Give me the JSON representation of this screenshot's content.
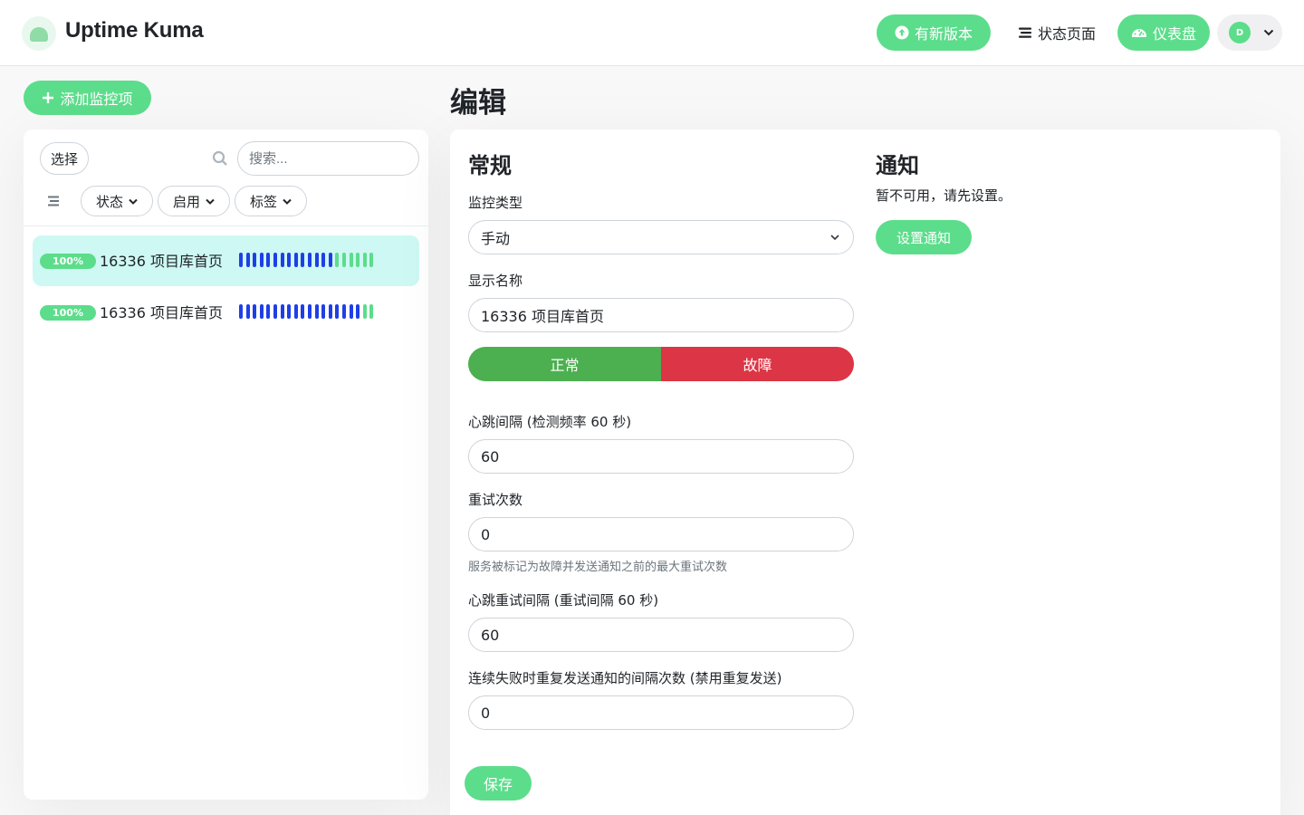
{
  "header": {
    "brand": "Uptime Kuma",
    "update_label": "有新版本",
    "status_page_label": "状态页面",
    "dashboard_label": "仪表盘",
    "avatar_initial": "D"
  },
  "sidebar": {
    "add_monitor_label": "添加监控项",
    "select_label": "选择",
    "search_placeholder": "搜索...",
    "filters": [
      "状态",
      "启用",
      "标签"
    ],
    "monitors": [
      {
        "uptime": "100%",
        "name": "16336 项目库首页",
        "active": true,
        "beats": [
          "down-blue",
          "down-blue",
          "down-blue",
          "down-blue",
          "down-blue",
          "down-blue",
          "down-blue",
          "down-blue",
          "down-blue",
          "down-blue",
          "down-blue",
          "down-blue",
          "down-blue",
          "down-blue",
          "up",
          "up",
          "up",
          "up",
          "up",
          "up"
        ]
      },
      {
        "uptime": "100%",
        "name": "16336 项目库首页",
        "active": false,
        "beats": [
          "down-blue",
          "down-blue",
          "down-blue",
          "down-blue",
          "down-blue",
          "down-blue",
          "down-blue",
          "down-blue",
          "down-blue",
          "down-blue",
          "down-blue",
          "down-blue",
          "down-blue",
          "down-blue",
          "down-blue",
          "down-blue",
          "down-blue",
          "down-blue",
          "up",
          "up"
        ]
      }
    ]
  },
  "main": {
    "page_title": "编辑",
    "general_title": "常规",
    "monitor_type_label": "监控类型",
    "monitor_type_value": "手动",
    "display_name_label": "显示名称",
    "display_name_value": "16336 项目库首页",
    "status_up_label": "正常",
    "status_down_label": "故障",
    "heartbeat_interval_label": "心跳间隔 (检测频率 60 秒)",
    "heartbeat_interval_value": "60",
    "retries_label": "重试次数",
    "retries_value": "0",
    "retries_help": "服务被标记为故障并发送通知之前的最大重试次数",
    "retry_interval_label": "心跳重试间隔 (重试间隔 60 秒)",
    "retry_interval_value": "60",
    "resend_label": "连续失败时重复发送通知的间隔次数 (禁用重复发送)",
    "resend_value": "0",
    "save_label": "保存",
    "notify_title": "通知",
    "notify_text": "暂不可用，请先设置。",
    "setup_notify_label": "设置通知"
  },
  "colors": {
    "primary": "#5cdd8b",
    "up": "#4caf50",
    "down": "#dc3545",
    "beat_blue": "#1f3fe6",
    "beat_green": "#5cdd8b",
    "active_item": "#cdf8f4"
  }
}
